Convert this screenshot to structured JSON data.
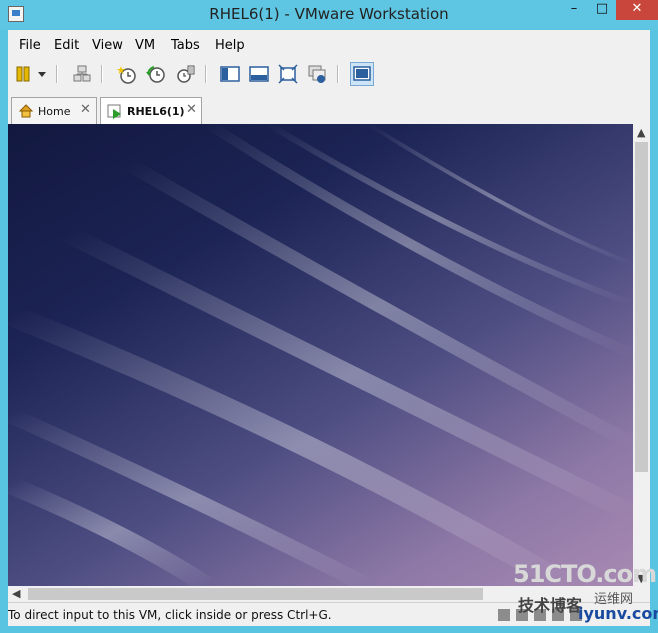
{
  "window": {
    "title": "RHEL6(1) - VMware Workstation"
  },
  "controls": {
    "minimize": "–",
    "maximize": "□",
    "close": "✕"
  },
  "menu": [
    "File",
    "Edit",
    "View",
    "VM",
    "Tabs",
    "Help"
  ],
  "tabs": [
    {
      "label": "Home",
      "icon": "home-icon",
      "close": "✕"
    },
    {
      "label": "RHEL6(1)",
      "icon": "vm-play-icon",
      "close": "✕",
      "active": true
    }
  ],
  "status": {
    "text": "To direct input to this VM, click inside or press Ctrl+G."
  },
  "watermark": {
    "line1": "51CTO.com",
    "line2": "技术博客",
    "line3": "iyunv.com",
    "line4": "运维网"
  }
}
